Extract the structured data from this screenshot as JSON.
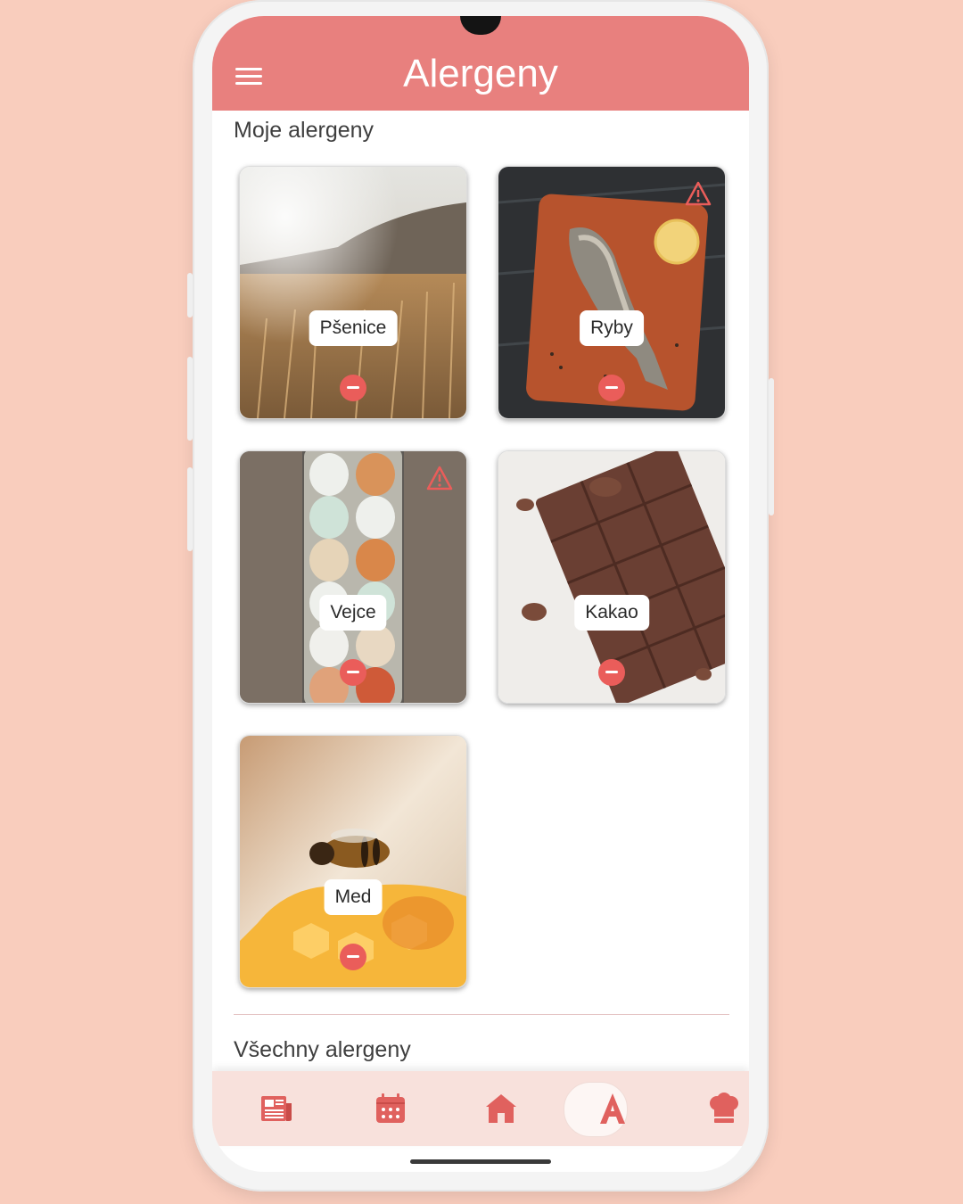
{
  "header": {
    "title": "Alergeny"
  },
  "sections": {
    "my_allergens": "Moje alergeny",
    "all_allergens": "Všechny alergeny"
  },
  "cards": [
    {
      "label": "Pšenice",
      "warning": false
    },
    {
      "label": "Ryby",
      "warning": true
    },
    {
      "label": "Vejce",
      "warning": true
    },
    {
      "label": "Kakao",
      "warning": false
    },
    {
      "label": "Med",
      "warning": false
    }
  ],
  "nav": {
    "items": [
      {
        "icon": "newspaper-icon",
        "active": false
      },
      {
        "icon": "calendar-icon",
        "active": false
      },
      {
        "icon": "home-icon",
        "active": false
      },
      {
        "icon": "allergen-a-icon",
        "active": true,
        "label": "A"
      },
      {
        "icon": "chef-hat-icon",
        "active": false
      }
    ]
  },
  "colors": {
    "accent": "#e8807e",
    "remove": "#ea5d5a",
    "background": "#f9cdbd",
    "nav_bg": "#f8e1dc"
  }
}
